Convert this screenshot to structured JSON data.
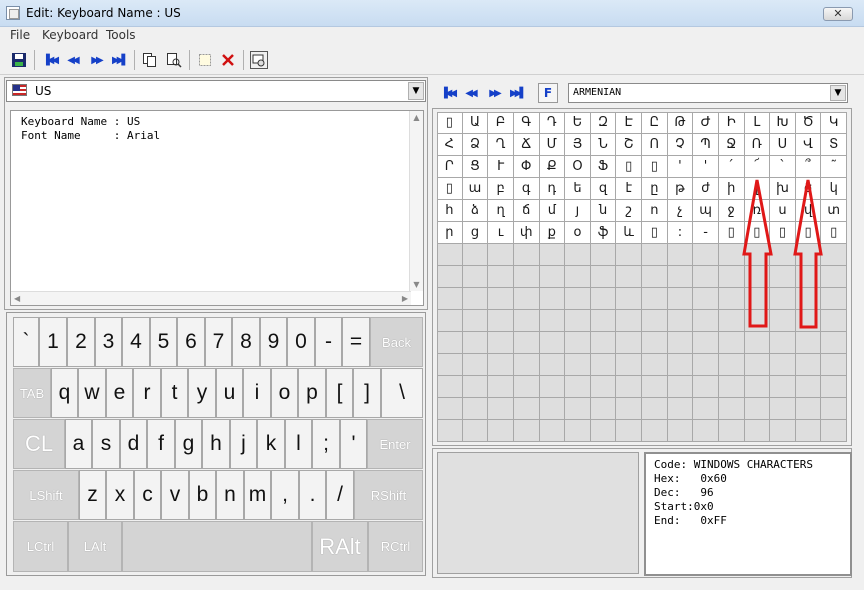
{
  "window": {
    "title": "Edit:  Keyboard Name : US",
    "close_label": "✕"
  },
  "menu": [
    "File",
    "Keyboard",
    "Tools"
  ],
  "toolbar": {
    "nav_first": "▐◀◀",
    "nav_prev": "◀◀",
    "nav_next": "▶▶",
    "nav_last": "▶▶▌"
  },
  "keyboard_select": {
    "value": "US",
    "flag_icon": "us-flag-icon"
  },
  "info": {
    "keyboard_name_line": "Keyboard Name : US",
    "font_name_line": "Font Name     : Arial"
  },
  "keyboard": {
    "row1": [
      "`",
      "1",
      "2",
      "3",
      "4",
      "5",
      "6",
      "7",
      "8",
      "9",
      "0",
      "-",
      "=",
      "Back"
    ],
    "row2": [
      "TAB",
      "q",
      "w",
      "e",
      "r",
      "t",
      "y",
      "u",
      "i",
      "o",
      "p",
      "[",
      "]",
      "\\"
    ],
    "row3": [
      "CL",
      "a",
      "s",
      "d",
      "f",
      "g",
      "h",
      "j",
      "k",
      "l",
      ";",
      "'",
      "Enter"
    ],
    "row4": [
      "LShift",
      "z",
      "x",
      "c",
      "v",
      "b",
      "n",
      "m",
      ",",
      ".",
      "/",
      "RShift"
    ],
    "row5": [
      "LCtrl",
      "LAlt",
      "",
      "RAlt",
      "RCtrl"
    ]
  },
  "charset": {
    "font_button": "F",
    "selected": "ARMENIAN"
  },
  "char_grid": [
    [
      "▯",
      "Ա",
      "Բ",
      "Գ",
      "Դ",
      "Ե",
      "Զ",
      "Է",
      "Ը",
      "Թ",
      "Ժ",
      "Ի",
      "Լ",
      "Խ",
      "Ծ",
      "Կ"
    ],
    [
      "Հ",
      "Ձ",
      "Ղ",
      "Ճ",
      "Մ",
      "Յ",
      "Ն",
      "Շ",
      "Ո",
      "Չ",
      "Պ",
      "Ջ",
      "Ռ",
      "Ս",
      "Վ",
      "Տ"
    ],
    [
      "Ր",
      "Ց",
      "Ւ",
      "Փ",
      "Ք",
      "Օ",
      "Ֆ",
      "▯",
      "▯",
      "'",
      "'",
      "՛",
      "՜",
      "`",
      "՞",
      "˜"
    ],
    [
      "▯",
      "ա",
      "բ",
      "գ",
      "դ",
      "ե",
      "զ",
      "է",
      "ը",
      "թ",
      "ժ",
      "ի",
      "լ",
      "խ",
      "ծ",
      "կ"
    ],
    [
      "հ",
      "ձ",
      "ղ",
      "ճ",
      "մ",
      "յ",
      "ն",
      "շ",
      "ո",
      "չ",
      "պ",
      "ջ",
      "ռ",
      "ս",
      "վ",
      "տ"
    ],
    [
      "ր",
      "ց",
      "ւ",
      "փ",
      "ք",
      "օ",
      "ֆ",
      "և",
      "▯",
      ":",
      "-",
      "▯",
      "▯",
      "▯",
      "▯",
      "▯"
    ]
  ],
  "char_details": {
    "code": "Code: WINDOWS CHARACTERS",
    "hex": "Hex:   0x60",
    "dec": "Dec:   96",
    "start": "Start:0x0",
    "end": "End:   0xFF"
  },
  "annotation_color": "#e01818"
}
